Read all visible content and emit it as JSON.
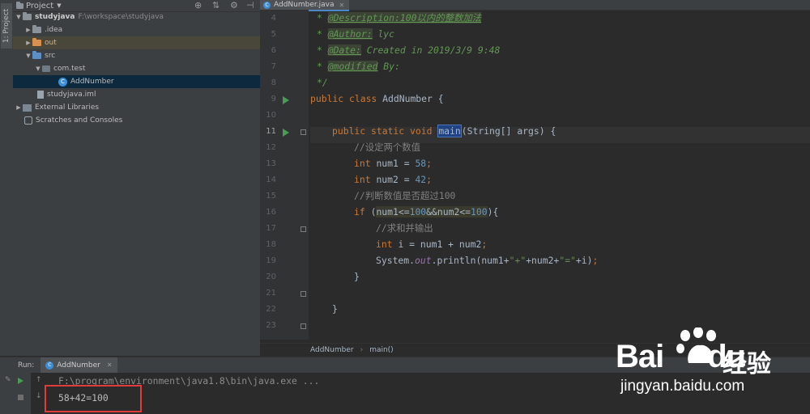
{
  "left_strip": {
    "tab_label": "1: Project"
  },
  "project": {
    "header": "Project",
    "tree": [
      {
        "name": "studyjava",
        "path": "F:\\workspace\\studyjava"
      },
      {
        "name": ".idea"
      },
      {
        "name": "out"
      },
      {
        "name": "src"
      },
      {
        "name": "com.test"
      },
      {
        "name": "AddNumber"
      },
      {
        "name": "studyjava.iml"
      },
      {
        "name": "External Libraries"
      },
      {
        "name": "Scratches and Consoles"
      }
    ]
  },
  "editor": {
    "tab": "AddNumber.java",
    "line_numbers": [
      "4",
      "5",
      "6",
      "7",
      "8",
      "9",
      "10",
      "11",
      "12",
      "13",
      "14",
      "15",
      "16",
      "17",
      "18",
      "19",
      "20",
      "21",
      "22",
      "23"
    ],
    "code": {
      "l4_tag": "@Description:100以内的整数加法",
      "l5_tag": "@Author:",
      "l5_val": " lyc",
      "l6_tag": "@Date:",
      "l6_val": " Created in 2019/3/9 9:48",
      "l7_tag": "@modified",
      "l7_val": " By:",
      "l8": "*/",
      "l9_kw": "public class ",
      "l9_rest": "AddNumber {",
      "l11_kw": "public static void ",
      "l11_main": "main",
      "l11_rest": "(String[] args) {",
      "l12": "//设定两个数值",
      "l13_kw": "int ",
      "l13_var": "num1 = ",
      "l13_num": "58",
      "l13_end": ";",
      "l14_kw": "int ",
      "l14_var": "num2 = ",
      "l14_num": "42",
      "l14_end": ";",
      "l15": "//判断数值是否超过100",
      "l16_kw": "if ",
      "l16_open": "(",
      "l16_a": "num1<=",
      "l16_n1": "100",
      "l16_b": "&&num2<=",
      "l16_n2": "100",
      "l16_close": "){",
      "l17": "//求和并输出",
      "l18_kw": "int ",
      "l18_rest": "i = num1 + num2",
      "l18_end": ";",
      "l19_a": "System.",
      "l19_out": "out",
      "l19_b": ".println(num1+",
      "l19_s1": "\"+\"",
      "l19_c": "+num2+",
      "l19_s2": "\"=\"",
      "l19_d": "+i)",
      "l19_end": ";",
      "l20": "}",
      "l22": "}"
    },
    "breadcrumbs": [
      "AddNumber",
      "main()"
    ]
  },
  "run": {
    "label": "Run:",
    "tab": "AddNumber",
    "command": "F:\\program\\environment\\java1.8\\bin\\java.exe ...",
    "output": "58+42=100"
  },
  "watermark": {
    "logo_left": "Bai",
    "logo_right": "du",
    "cn": "经验",
    "url": "jingyan.baidu.com"
  },
  "colors": {
    "accent": "#4a88c7",
    "highlight_box": "#e03c3c",
    "run_green": "#499c54"
  }
}
